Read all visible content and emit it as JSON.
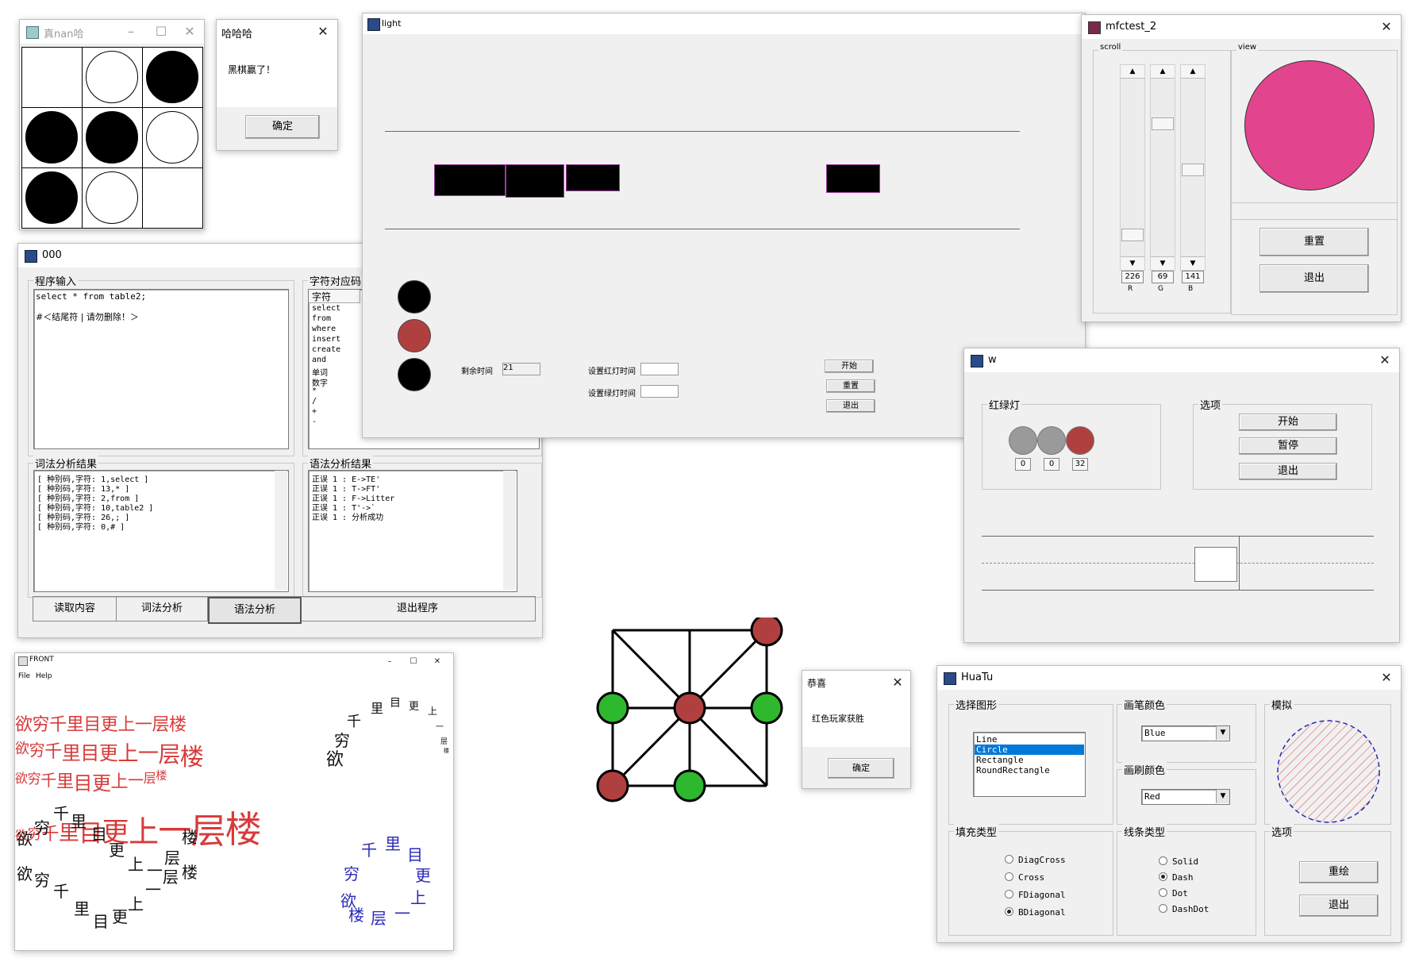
{
  "reversi": {
    "title": "真nan哈",
    "board": [
      "empty",
      "white",
      "black",
      "black",
      "black",
      "white",
      "black",
      "white",
      "empty"
    ]
  },
  "reversi_dialog": {
    "title": "哈哈哈",
    "message": "黑棋赢了！",
    "ok": "确定"
  },
  "light": {
    "title": "light",
    "remaining_label": "剩余时间",
    "remaining_value": "21",
    "red_label": "设置红灯时间",
    "green_label": "设置绿灯时间",
    "start": "开始",
    "reset": "重置",
    "exit": "退出",
    "lights": [
      "#000000",
      "#b0403f",
      "#000000"
    ]
  },
  "mfc": {
    "title": "mfctest_2",
    "scroll_group": "scroll",
    "view_group": "view",
    "r_value": "226",
    "g_value": "69",
    "b_value": "141",
    "r_label": "R",
    "g_label": "G",
    "b_label": "B",
    "circle_color": "#e2458d",
    "reset": "重置",
    "exit": "退出"
  },
  "compiler": {
    "title": "000",
    "input_group": "程序输入",
    "input_line1": "select * from table2;",
    "input_line2": "#＜结尾符 | 请勿删除！＞",
    "table_group": "字符对应码",
    "table_header": "字符",
    "table_rows": [
      "select",
      "from",
      "where",
      "insert",
      "create",
      "and",
      "单词",
      "数字",
      "*",
      "/",
      "+",
      "-"
    ],
    "lex_group": "词法分析结果",
    "lex_lines": [
      "[ 种别码,字符: 1,select ]",
      "[ 种别码,字符: 13,* ]",
      "[ 种别码,字符: 2,from ]",
      "[ 种别码,字符: 10,table2 ]",
      "[ 种别码,字符: 26,; ]",
      "[ 种别码,字符: 0,# ]"
    ],
    "syn_group": "语法分析结果",
    "syn_lines": [
      "正误 1 : E->TE'",
      "正误 1 : T->FT'",
      "正误 1 : F->Litter",
      "正误 1 : T'->`",
      "正误 1 : 分析成功"
    ],
    "btn_read": "读取内容",
    "btn_lex": "词法分析",
    "btn_syn": "语法分析",
    "btn_exit": "退出程序"
  },
  "w": {
    "title": "w",
    "light_group": "红绿灯",
    "options_group": "选项",
    "values": [
      "0",
      "0",
      "32"
    ],
    "start": "开始",
    "pause": "暂停",
    "exit": "退出",
    "light_colors": [
      "#9a9a9a",
      "#9a9a9a",
      "#b0403f"
    ]
  },
  "front": {
    "title": "FRONT",
    "menu_file": "File",
    "menu_help": "Help",
    "poem": "欲穷千里目更上一层楼"
  },
  "board_game": {
    "red": "#b0403f",
    "green": "#2eb82e"
  },
  "congrats": {
    "title": "恭喜",
    "message": "红色玩家获胜",
    "ok": "确定"
  },
  "huatu": {
    "title": "HuaTu",
    "shape_group": "选择图形",
    "shapes": [
      "Line",
      "Circle",
      "Rectangle",
      "RoundRectangle"
    ],
    "pen_group": "画笔颜色",
    "pen_value": "Blue",
    "brush_group": "画刷颜色",
    "brush_value": "Red",
    "sim_group": "模拟",
    "fill_group": "填充类型",
    "fills": [
      "DiagCross",
      "Cross",
      "FDiagonal",
      "BDiagonal"
    ],
    "line_group": "线条类型",
    "lines": [
      "Solid",
      "Dash",
      "Dot",
      "DashDot"
    ],
    "opt_group": "选项",
    "redraw": "重绘",
    "exit": "退出"
  }
}
